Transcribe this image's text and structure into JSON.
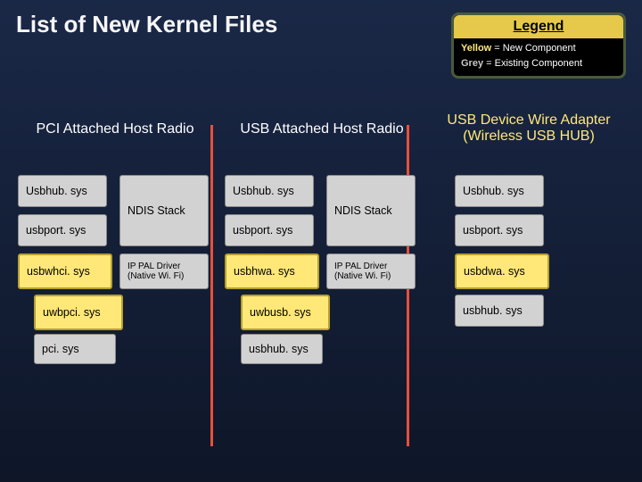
{
  "title": "List of New Kernel Files",
  "legend": {
    "title": "Legend",
    "row1_color": "Yellow",
    "row1_rest": " = New Component",
    "row2_color": "Grey",
    "row2_rest": " = Existing Component"
  },
  "columns": {
    "col1": {
      "heading": "PCI Attached Host Radio",
      "left": {
        "g1": "Usbhub. sys",
        "g2": "usbport. sys",
        "y1": "usbwhci. sys",
        "y2": "uwbpci. sys",
        "g3": "pci. sys"
      },
      "right": {
        "g1": "NDIS Stack",
        "g2": "IP PAL Driver (Native Wi. Fi)"
      }
    },
    "col2": {
      "heading": "USB Attached Host Radio",
      "left": {
        "g1": "Usbhub. sys",
        "g2": "usbport. sys",
        "y1": "usbhwa. sys",
        "y2": "uwbusb. sys",
        "g3": "usbhub. sys"
      },
      "right": {
        "g1": "NDIS Stack",
        "g2": "IP PAL Driver (Native Wi. Fi)"
      }
    },
    "col3": {
      "heading": "USB Device Wire Adapter (Wireless USB HUB)",
      "left": {
        "g1": "Usbhub. sys",
        "g2": "usbport. sys",
        "y1": "usbdwa. sys",
        "g3": "usbhub. sys"
      }
    }
  }
}
